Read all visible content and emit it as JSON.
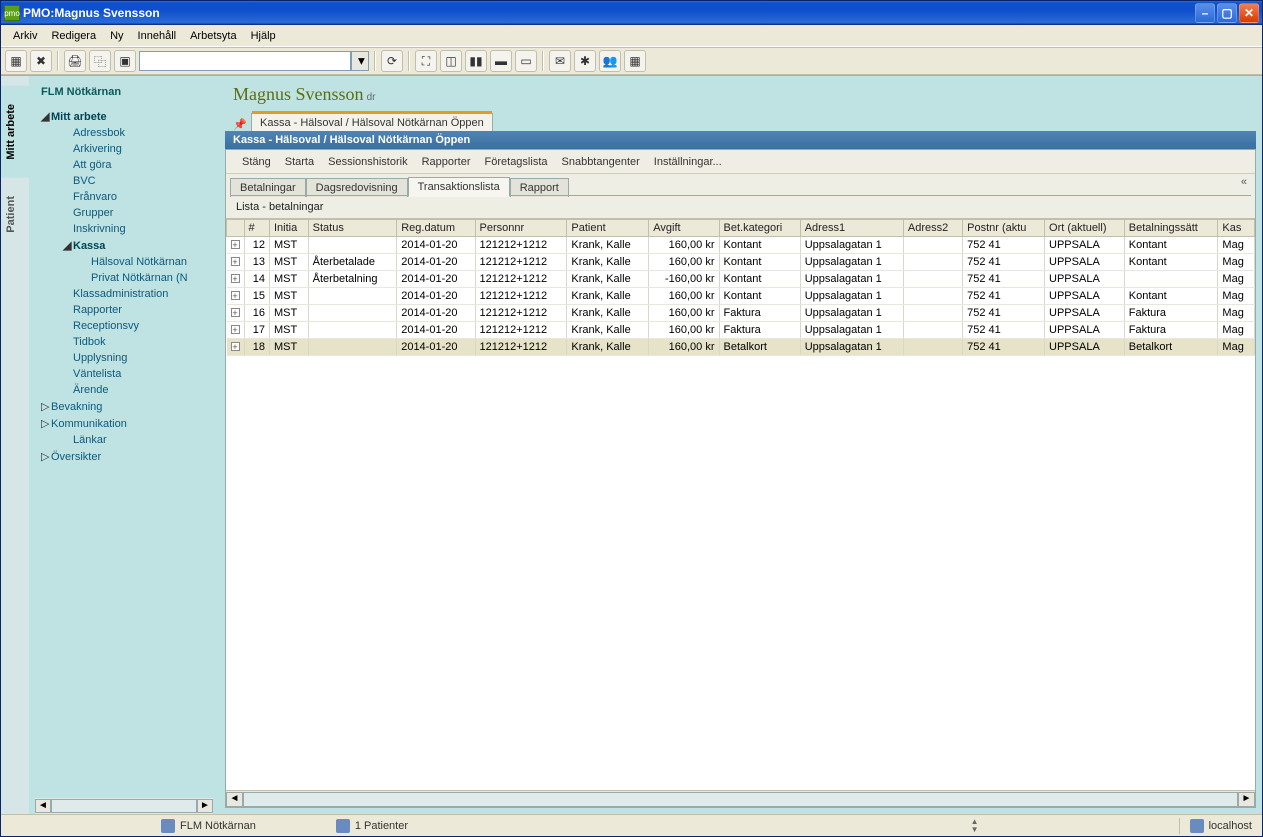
{
  "window": {
    "title": "PMO:Magnus Svensson",
    "icon_label": "pmo"
  },
  "menubar": [
    "Arkiv",
    "Redigera",
    "Ny",
    "Innehåll",
    "Arbetsyta",
    "Hjälp"
  ],
  "sidetabs": {
    "top": "Mitt arbete",
    "bottom": "Patient"
  },
  "nav": {
    "org": "FLM Nötkärnan",
    "items": [
      {
        "level": 0,
        "exp": "◢",
        "label": "Mitt arbete",
        "bold": true
      },
      {
        "level": 1,
        "exp": "",
        "label": "Adressbok"
      },
      {
        "level": 1,
        "exp": "",
        "label": "Arkivering"
      },
      {
        "level": 1,
        "exp": "",
        "label": "Att göra"
      },
      {
        "level": 1,
        "exp": "",
        "label": "BVC"
      },
      {
        "level": 1,
        "exp": "",
        "label": "Frånvaro"
      },
      {
        "level": 1,
        "exp": "",
        "label": "Grupper"
      },
      {
        "level": 1,
        "exp": "",
        "label": "Inskrivning"
      },
      {
        "level": 1,
        "exp": "◢",
        "label": "Kassa",
        "bold": true
      },
      {
        "level": 2,
        "exp": "",
        "label": "Hälsoval Nötkärnan"
      },
      {
        "level": 2,
        "exp": "",
        "label": "Privat Nötkärnan (N"
      },
      {
        "level": 1,
        "exp": "",
        "label": "Klassadministration"
      },
      {
        "level": 1,
        "exp": "",
        "label": "Rapporter"
      },
      {
        "level": 1,
        "exp": "",
        "label": "Receptionsvy"
      },
      {
        "level": 1,
        "exp": "",
        "label": "Tidbok"
      },
      {
        "level": 1,
        "exp": "",
        "label": "Upplysning"
      },
      {
        "level": 1,
        "exp": "",
        "label": "Väntelista"
      },
      {
        "level": 1,
        "exp": "",
        "label": "Ärende"
      },
      {
        "level": 0,
        "exp": "▷",
        "label": "Bevakning"
      },
      {
        "level": 0,
        "exp": "▷",
        "label": "Kommunikation"
      },
      {
        "level": 1,
        "exp": "",
        "label": "Länkar"
      },
      {
        "level": 0,
        "exp": "▷",
        "label": "Översikter"
      }
    ]
  },
  "patient": {
    "name": "Magnus Svensson",
    "role": "dr"
  },
  "tab_top": "Kassa - Hälsoval / Hälsoval Nötkärnan Öppen",
  "panel_title": "Kassa - Hälsoval / Hälsoval Nötkärnan Öppen",
  "panel_menu": [
    "Stäng",
    "Starta",
    "Sessionshistorik",
    "Rapporter",
    "Företagslista",
    "Snabbtangenter",
    "Inställningar..."
  ],
  "sub_tabs": [
    "Betalningar",
    "Dagsredovisning",
    "Transaktionslista",
    "Rapport"
  ],
  "sub_tab_active": 2,
  "list_header": "Lista     - betalningar",
  "columns": [
    "",
    "#",
    "Initia",
    "Status",
    "Reg.datum",
    "Personnr",
    "Patient",
    "Avgift",
    "Bet.kategori",
    "Adress1",
    "Adress2",
    "Postnr (aktu",
    "Ort (aktuell)",
    "Betalningssätt",
    "Kas"
  ],
  "rows": [
    {
      "n": "12",
      "init": "MST",
      "status": "",
      "date": "2014-01-20",
      "pnr": "121212+1212",
      "pat": "Krank, Kalle",
      "avg": "160,00 kr",
      "kat": "Kontant",
      "a1": "Uppsalagatan 1",
      "a2": "",
      "post": "752 41",
      "ort": "UPPSALA",
      "bs": "Kontant",
      "kas": "Mag"
    },
    {
      "n": "13",
      "init": "MST",
      "status": "Återbetalade",
      "date": "2014-01-20",
      "pnr": "121212+1212",
      "pat": "Krank, Kalle",
      "avg": "160,00 kr",
      "kat": "Kontant",
      "a1": "Uppsalagatan 1",
      "a2": "",
      "post": "752 41",
      "ort": "UPPSALA",
      "bs": "Kontant",
      "kas": "Mag"
    },
    {
      "n": "14",
      "init": "MST",
      "status": "Återbetalning",
      "date": "2014-01-20",
      "pnr": "121212+1212",
      "pat": "Krank, Kalle",
      "avg": "-160,00 kr",
      "kat": "Kontant",
      "a1": "Uppsalagatan 1",
      "a2": "",
      "post": "752 41",
      "ort": "UPPSALA",
      "bs": "",
      "kas": "Mag"
    },
    {
      "n": "15",
      "init": "MST",
      "status": "",
      "date": "2014-01-20",
      "pnr": "121212+1212",
      "pat": "Krank, Kalle",
      "avg": "160,00 kr",
      "kat": "Kontant",
      "a1": "Uppsalagatan 1",
      "a2": "",
      "post": "752 41",
      "ort": "UPPSALA",
      "bs": "Kontant",
      "kas": "Mag"
    },
    {
      "n": "16",
      "init": "MST",
      "status": "",
      "date": "2014-01-20",
      "pnr": "121212+1212",
      "pat": "Krank, Kalle",
      "avg": "160,00 kr",
      "kat": "Faktura",
      "a1": "Uppsalagatan 1",
      "a2": "",
      "post": "752 41",
      "ort": "UPPSALA",
      "bs": "Faktura",
      "kas": "Mag"
    },
    {
      "n": "17",
      "init": "MST",
      "status": "",
      "date": "2014-01-20",
      "pnr": "121212+1212",
      "pat": "Krank, Kalle",
      "avg": "160,00 kr",
      "kat": "Faktura",
      "a1": "Uppsalagatan 1",
      "a2": "",
      "post": "752 41",
      "ort": "UPPSALA",
      "bs": "Faktura",
      "kas": "Mag"
    },
    {
      "n": "18",
      "init": "MST",
      "status": "",
      "date": "2014-01-20",
      "pnr": "121212+1212",
      "pat": "Krank, Kalle",
      "avg": "160,00 kr",
      "kat": "Betalkort",
      "a1": "Uppsalagatan 1",
      "a2": "",
      "post": "752 41",
      "ort": "UPPSALA",
      "bs": "Betalkort",
      "kas": "Mag"
    }
  ],
  "status": {
    "org": "FLM Nötkärnan",
    "patients": "1 Patienter",
    "host": "localhost"
  }
}
